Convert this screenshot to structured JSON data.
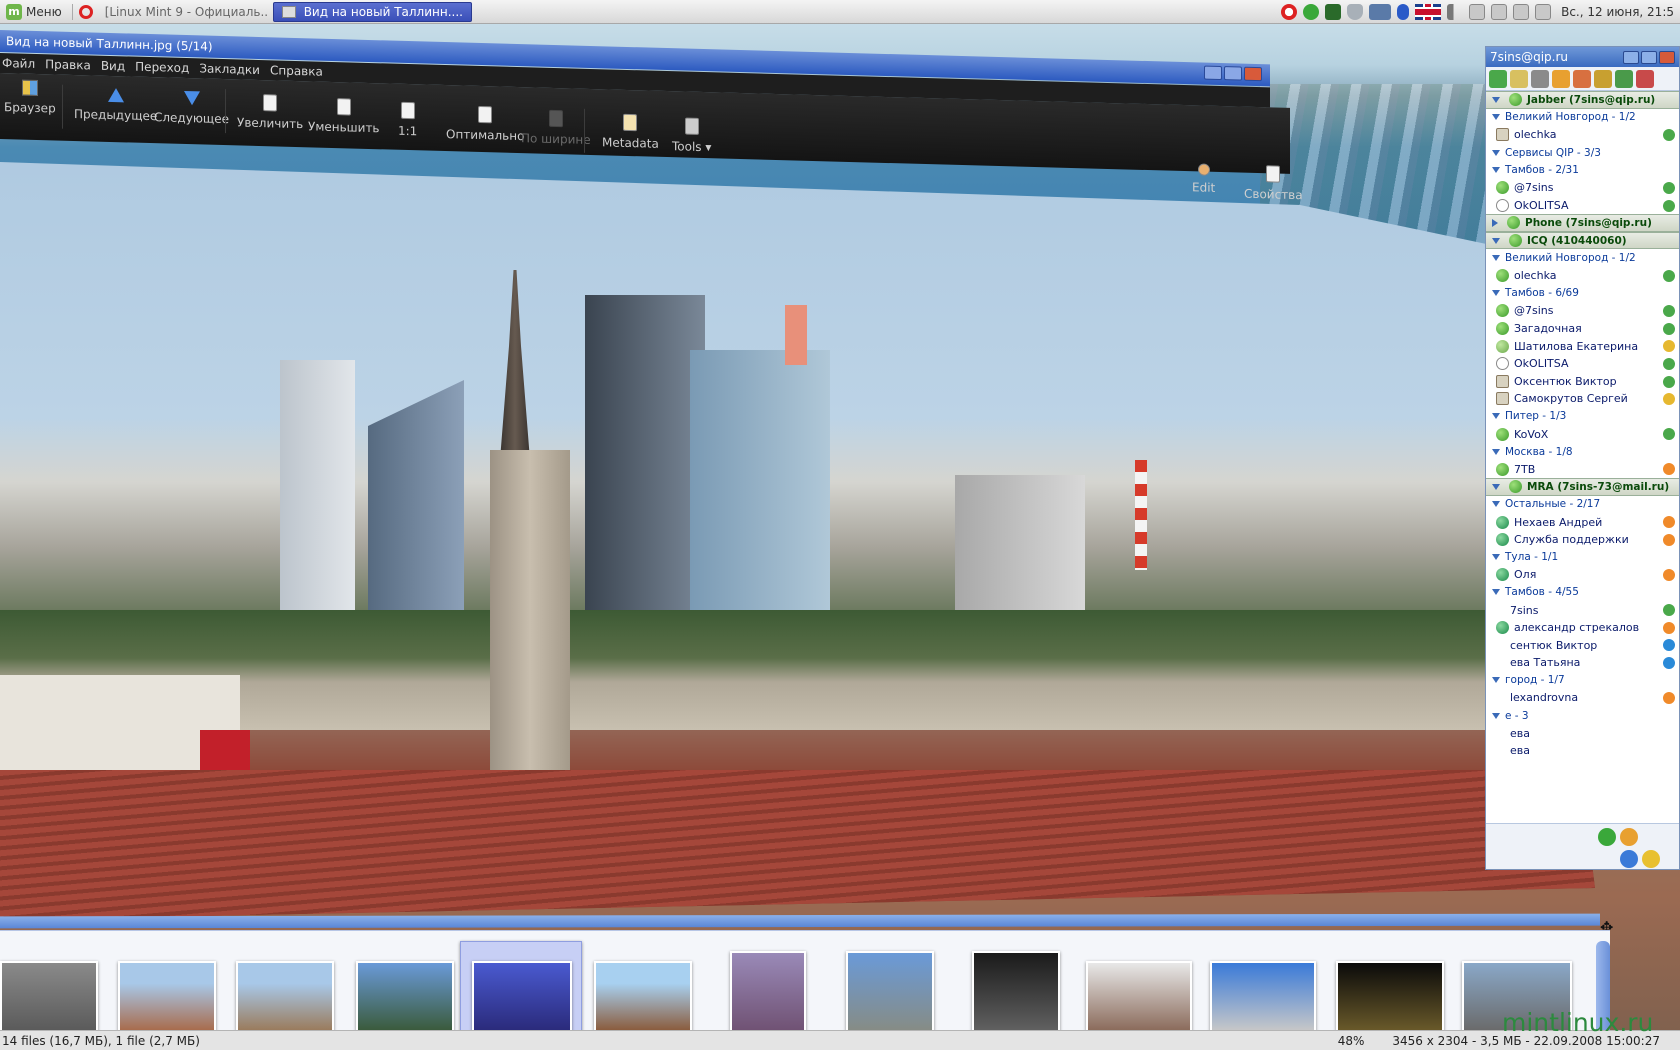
{
  "panel": {
    "menu_label": "Меню",
    "tasks": [
      {
        "label": "[Linux Mint 9 - Официаль...",
        "active": false
      },
      {
        "label": "Вид на новый Таллинн....",
        "active": true
      }
    ],
    "clock": "Вс., 12 июня, 21:5",
    "tray_icons": [
      "opera-icon",
      "shield-check-icon",
      "qip-icon",
      "shield-icon",
      "network-icon",
      "bluetooth-icon",
      "uk-flag-icon",
      "volume-icon"
    ]
  },
  "viewer": {
    "title": "Вид на новый Таллинн.jpg (5/14)",
    "menu": [
      "Файл",
      "Правка",
      "Вид",
      "Переход",
      "Закладки",
      "Справка"
    ],
    "toolbar": {
      "browser": "Браузер",
      "previous": "Предыдущее",
      "next": "Следующее",
      "zoom_in": "Увеличить",
      "zoom_out": "Уменьшить",
      "one_to_one": "1:1",
      "optimal": "Оптимально",
      "fit_width": "По ширине",
      "metadata": "Metadata",
      "tools": "Tools ▾",
      "edit": "Edit",
      "properties": "Свойства"
    },
    "status_left": "14 files (16,7 МБ), 1 file (2,7 МБ)",
    "status_zoom": "48%",
    "status_info": "3456 x 2304 - 3,5 МБ - 22.09.2008 15:00:27",
    "thumbnail_count": 13,
    "selected_thumbnail": 5
  },
  "qip": {
    "title": "7sins@qip.ru",
    "rows": [
      {
        "type": "account",
        "label": "Jabber (7sins@qip.ru)"
      },
      {
        "type": "group",
        "label": "Великий Новгород - 1/2"
      },
      {
        "type": "contact",
        "label": "olechka",
        "status": "na",
        "side": "green"
      },
      {
        "type": "group",
        "label": "Сервисы QIP - 3/3"
      },
      {
        "type": "group",
        "label": "Тамбов - 2/31"
      },
      {
        "type": "contact",
        "label": "@7sins",
        "status": "online",
        "side": "green"
      },
      {
        "type": "contact",
        "label": "OkOLITSA",
        "status": "offline",
        "side": "green"
      },
      {
        "type": "account-collapsed",
        "label": "Phone (7sins@qip.ru)"
      },
      {
        "type": "account",
        "label": "ICQ (410440060)"
      },
      {
        "type": "group",
        "label": "Великий Новгород - 1/2"
      },
      {
        "type": "contact",
        "label": "olechka",
        "status": "online",
        "side": "green"
      },
      {
        "type": "group",
        "label": "Тамбов - 6/69"
      },
      {
        "type": "contact",
        "label": "@7sins",
        "status": "online",
        "side": "green"
      },
      {
        "type": "contact",
        "label": "Загадочная",
        "status": "online",
        "side": "green"
      },
      {
        "type": "contact",
        "label": "Шатилова Екатерина",
        "status": "away",
        "side": "yellow"
      },
      {
        "type": "contact",
        "label": "OkOLITSA",
        "status": "offline",
        "side": "green"
      },
      {
        "type": "contact",
        "label": "Оксентюк Виктор",
        "status": "na",
        "side": "green"
      },
      {
        "type": "contact",
        "label": "Самокрутов Сергей",
        "status": "na",
        "side": "yellow"
      },
      {
        "type": "group",
        "label": "Питер - 1/3"
      },
      {
        "type": "contact",
        "label": "KoVoX",
        "status": "online",
        "side": "green"
      },
      {
        "type": "group",
        "label": "Москва - 1/8"
      },
      {
        "type": "contact",
        "label": "7ТВ",
        "status": "online",
        "side": "orange"
      },
      {
        "type": "account",
        "label": "MRA (7sins-73@mail.ru)"
      },
      {
        "type": "group",
        "label": "Остальные - 2/17"
      },
      {
        "type": "contact",
        "label": "Нехаев Андрей",
        "status": "mail",
        "side": "orange"
      },
      {
        "type": "contact",
        "label": "Служба поддержки",
        "status": "mail",
        "side": "orange"
      },
      {
        "type": "group",
        "label": "Тула - 1/1"
      },
      {
        "type": "contact",
        "label": "Оля",
        "status": "mail",
        "side": "orange"
      },
      {
        "type": "group",
        "label": "Тамбов - 4/55"
      },
      {
        "type": "contact",
        "label": "7sins",
        "status": "none",
        "side": "green"
      },
      {
        "type": "contact",
        "label": "александр стрекалов",
        "status": "mail",
        "side": "orange"
      },
      {
        "type": "contact",
        "label": "сентюк Виктор",
        "status": "none",
        "side": "blue"
      },
      {
        "type": "contact",
        "label": "ева Татьяна",
        "status": "none",
        "side": "blue"
      },
      {
        "type": "group",
        "label": "город - 1/7"
      },
      {
        "type": "contact",
        "label": "lexandrovna",
        "status": "none",
        "side": "orange"
      },
      {
        "type": "group",
        "label": "е - 3"
      },
      {
        "type": "contact",
        "label": "ева",
        "status": "none",
        "side": ""
      },
      {
        "type": "contact",
        "label": "ева",
        "status": "none",
        "side": ""
      }
    ]
  },
  "watermark": "mintlinux.ru"
}
